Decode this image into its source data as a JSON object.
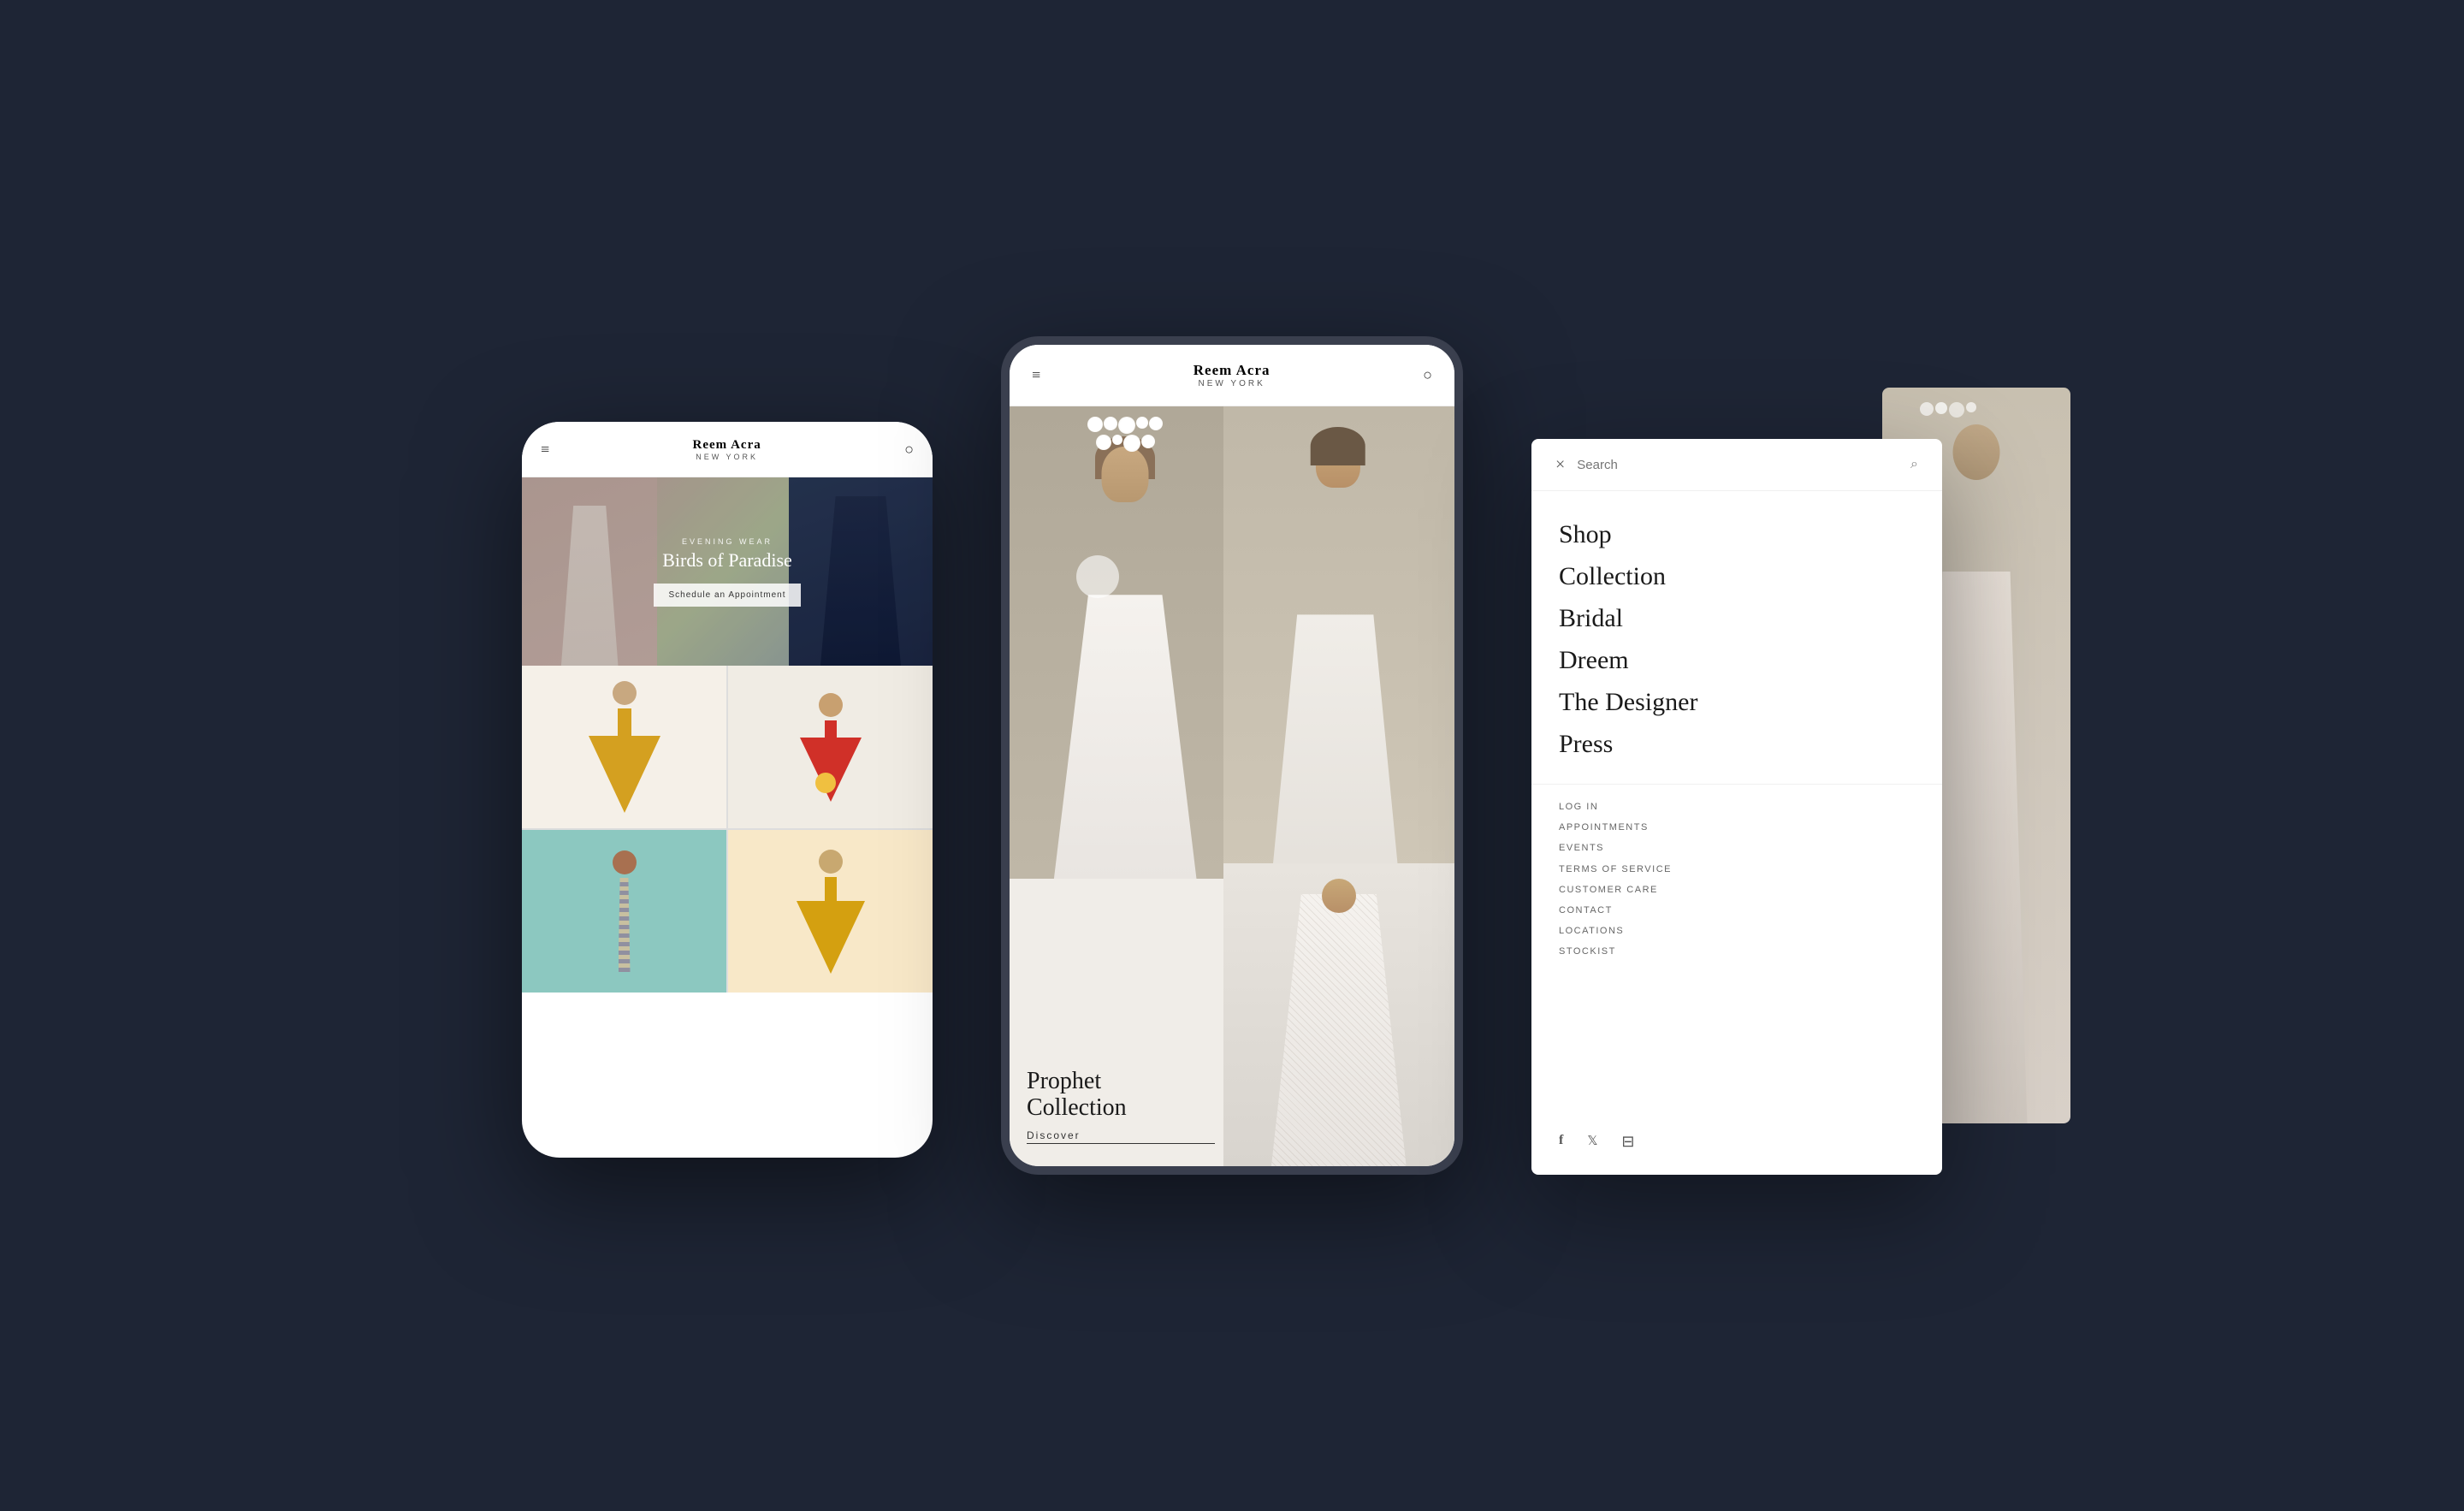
{
  "background": "#1e2535",
  "phone_left": {
    "brand": "Reem Acra",
    "brand_location": "NEW YORK",
    "hero": {
      "subtitle": "EVENING WEAR",
      "title": "Birds of Paradise",
      "button": "Schedule an Appointment"
    },
    "grid": [
      {
        "label": "yellow dress",
        "color": "yellow"
      },
      {
        "label": "red dress",
        "color": "red"
      },
      {
        "label": "stripe dress",
        "color": "stripe"
      },
      {
        "label": "tulle dress",
        "color": "tulle"
      }
    ]
  },
  "phone_center": {
    "brand": "Reem Acra",
    "brand_location": "NEW YORK",
    "collection": {
      "title": "Prophet\nCollection",
      "cta": "Discover"
    }
  },
  "menu_panel": {
    "search_placeholder": "Search",
    "close_icon": "×",
    "nav_items": [
      {
        "label": "Shop"
      },
      {
        "label": "Collection"
      },
      {
        "label": "Bridal"
      },
      {
        "label": "Dreem"
      },
      {
        "label": "The Designer"
      },
      {
        "label": "Press"
      }
    ],
    "secondary_items": [
      {
        "label": "LOG IN"
      },
      {
        "label": "APPOINTMENTS"
      },
      {
        "label": "EVENTS"
      },
      {
        "label": "TERMS OF SERVICE"
      },
      {
        "label": "CUSTOMER CARE"
      },
      {
        "label": "CONTACT"
      },
      {
        "label": "LOCATIONS"
      },
      {
        "label": "STOCKIST"
      }
    ],
    "social": {
      "facebook": "f",
      "twitter": "t",
      "instagram": "⊡"
    }
  }
}
